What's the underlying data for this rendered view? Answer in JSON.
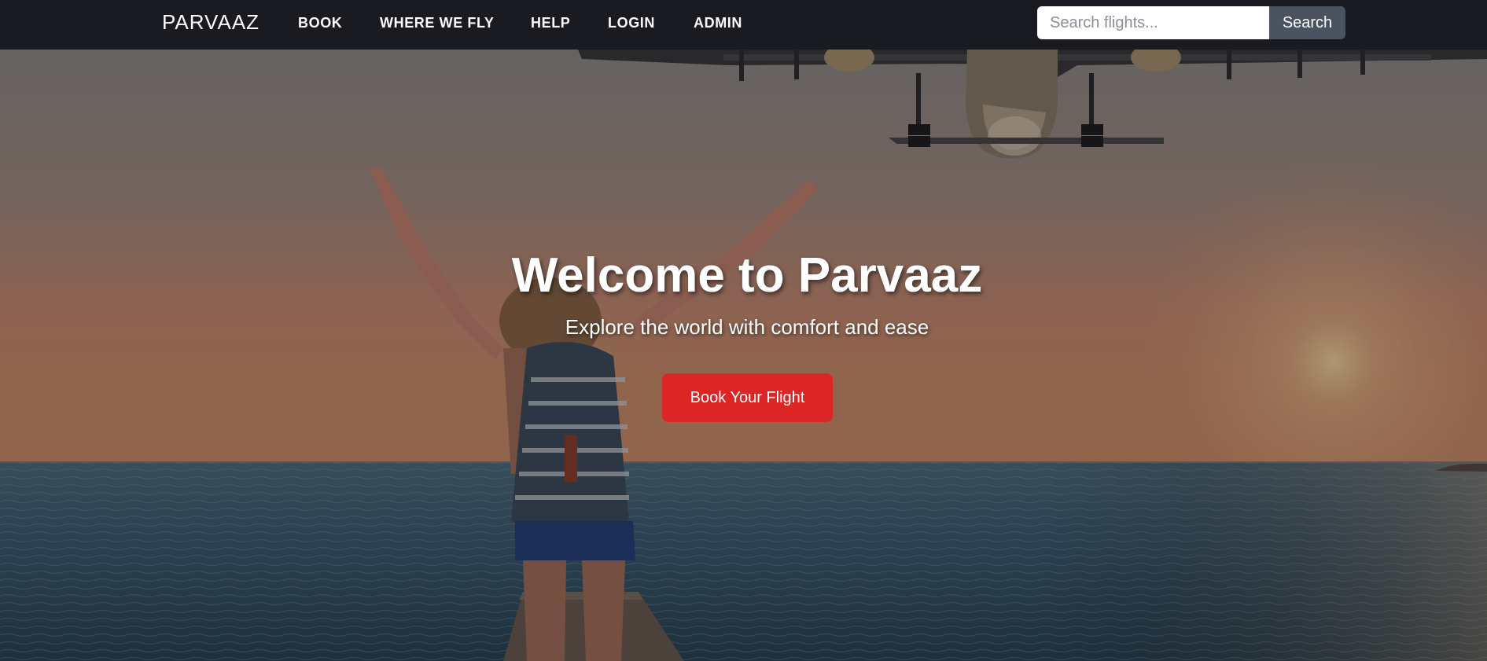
{
  "navbar": {
    "brand": "PARVAAZ",
    "links": [
      "BOOK",
      "WHERE WE FLY",
      "HELP",
      "LOGIN",
      "ADMIN"
    ],
    "search": {
      "placeholder": "Search flights...",
      "value": "",
      "button_label": "Search"
    }
  },
  "hero": {
    "title": "Welcome to Parvaaz",
    "subtitle": "Explore the world with comfort and ease",
    "cta_label": "Book Your Flight",
    "background_image": "photo-woman-with-backpack-arms-raised-on-pier-at-sunset-sea-with-airplane-overhead"
  },
  "colors": {
    "navbar_bg": "#191b20",
    "cta_red": "#dc2626",
    "search_button_bg": "#4a5360"
  }
}
